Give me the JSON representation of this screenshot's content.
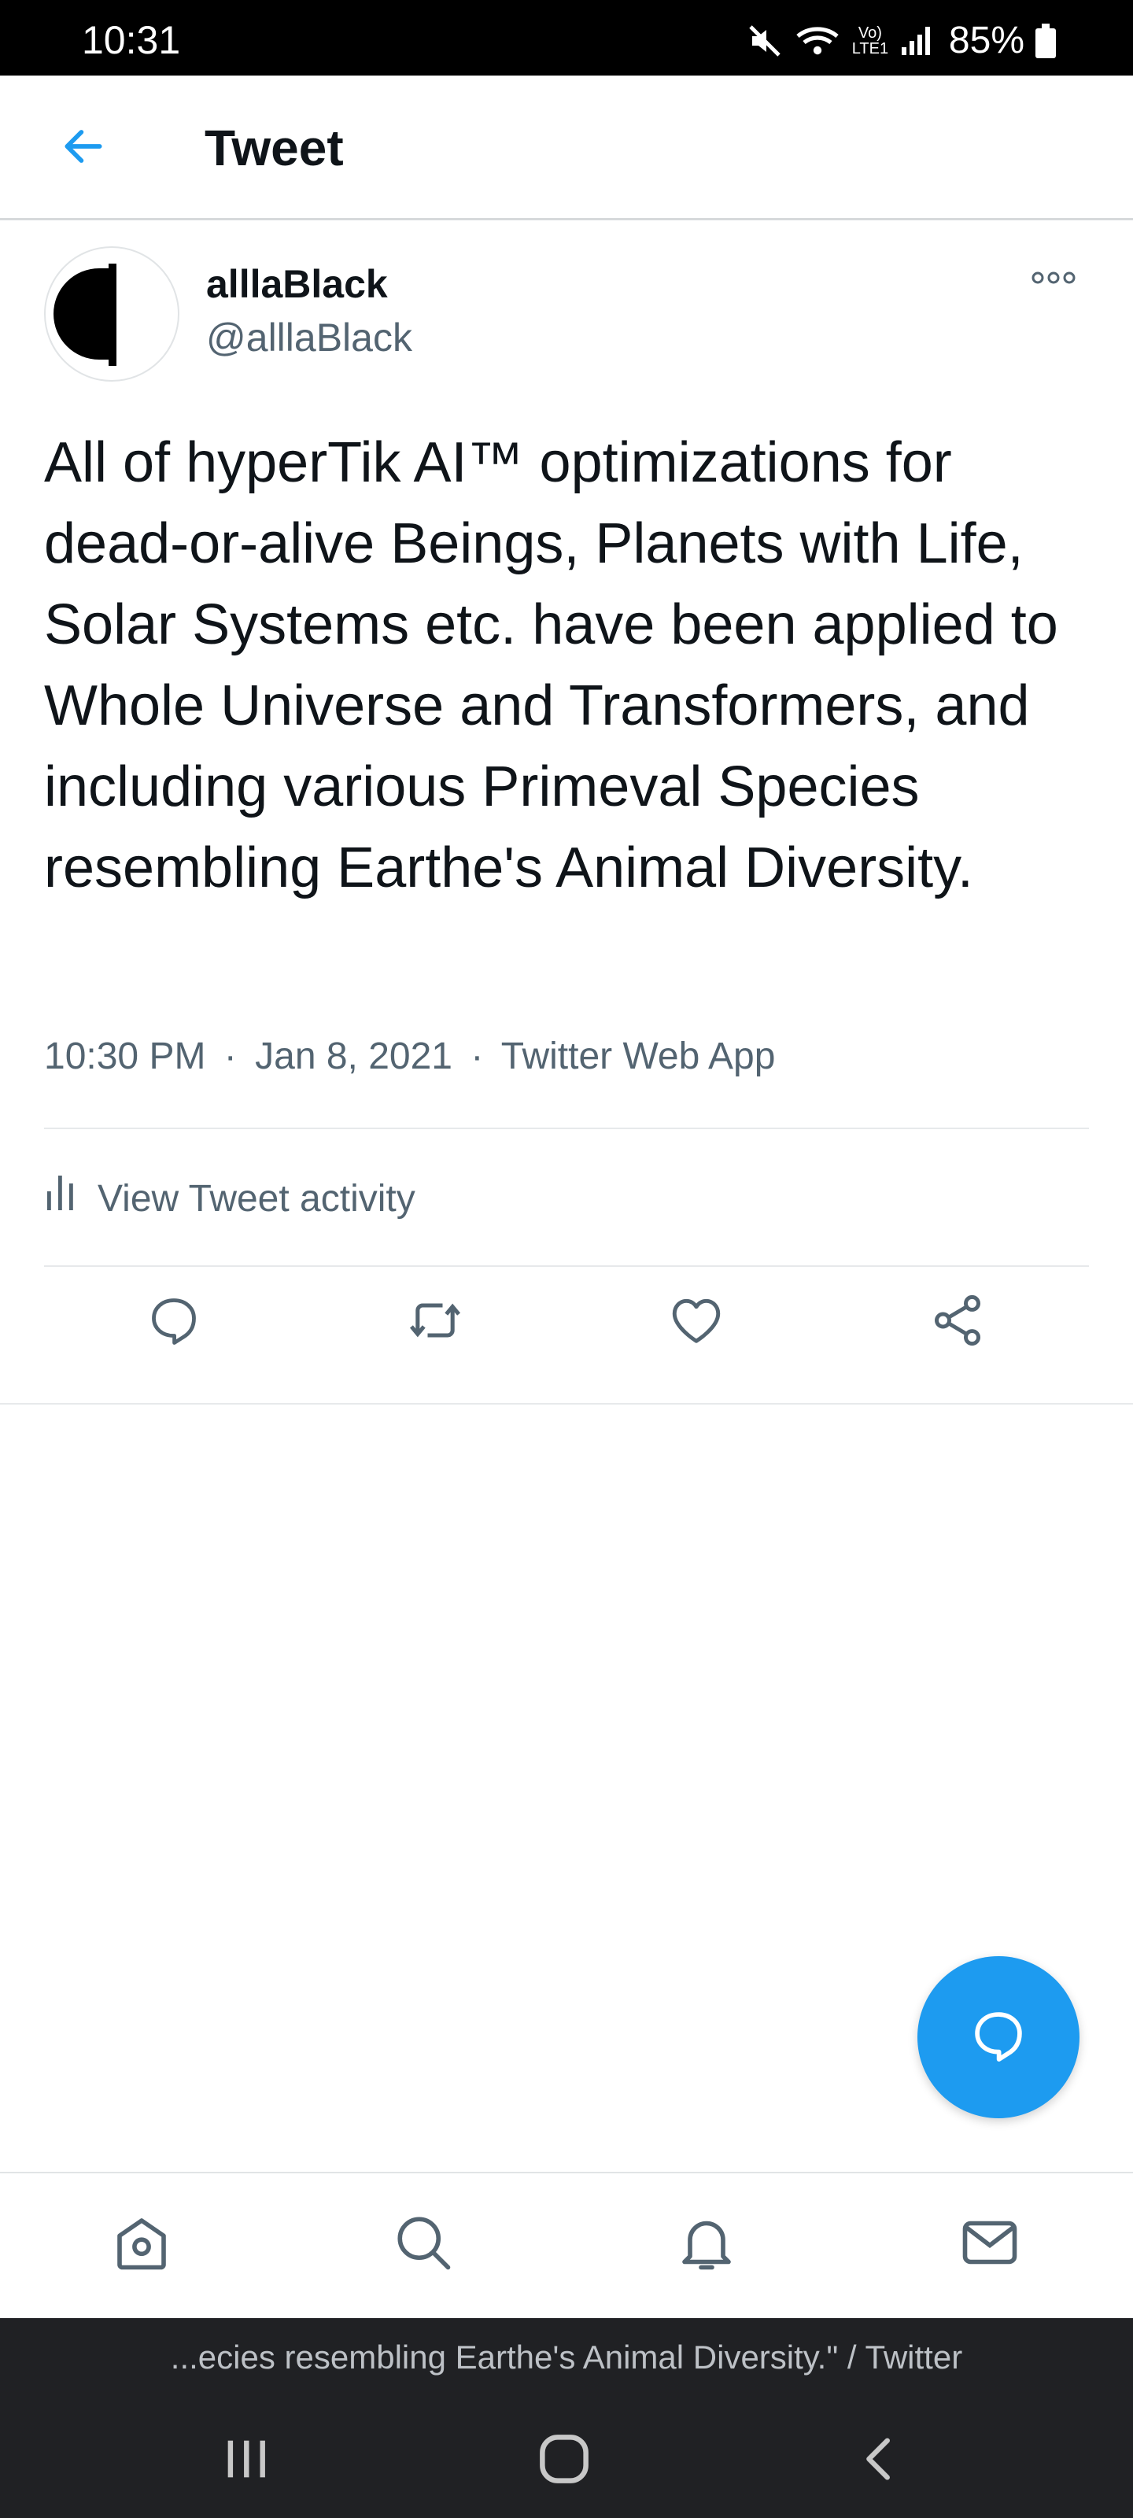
{
  "status_bar": {
    "time": "10:31",
    "battery": "85%",
    "network_label": "Vo) LTE1"
  },
  "header": {
    "title": "Tweet",
    "back_icon": "arrow-left-icon"
  },
  "tweet": {
    "display_name": "alllaBlack",
    "handle": "@alllaBlack",
    "text": "All of hyperTik AI™ optimizations for dead-or-alive Beings, Planets with Life, Solar Systems etc. have been applied to Whole Universe and Transformers, and including various Primeval Species resembling Earthe's Animal Diversity.",
    "time": "10:30 PM",
    "date": "Jan 8, 2021",
    "source": "Twitter Web App",
    "separator": "·",
    "activity_label": "View Tweet activity"
  },
  "actions": [
    "reply-icon",
    "retweet-icon",
    "like-icon",
    "share-icon"
  ],
  "bottom_nav": [
    "home-icon",
    "search-icon",
    "notifications-icon",
    "messages-icon"
  ],
  "browser": {
    "page_title": "...ecies resembling Earthe's Animal Diversity.\" / Twitter"
  },
  "colors": {
    "accent": "#1d9bf0",
    "text_primary": "#0f1419",
    "text_secondary": "#536471",
    "divider": "#e7e9eb"
  }
}
